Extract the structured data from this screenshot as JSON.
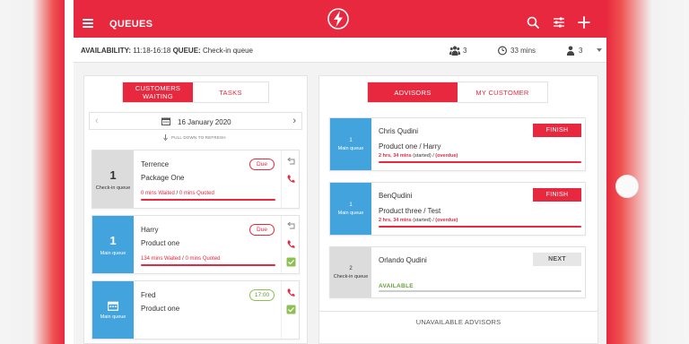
{
  "header": {
    "title": "QUEUES",
    "brand_color": "#e8283f",
    "icons": [
      "menu-icon",
      "lightning-logo-icon",
      "search-icon",
      "filter-sliders-icon",
      "plus-icon"
    ]
  },
  "availability_bar": {
    "availability_label": "AVAILABILITY:",
    "availability_value": "11:18-16:18",
    "queue_label": "QUEUE:",
    "queue_value": "Check-in queue",
    "people_count": "3",
    "wait_time": "33 mins",
    "advisors_count": "3"
  },
  "left_panel": {
    "tabs": [
      {
        "label": "CUSTOMERS WAITING",
        "active": true
      },
      {
        "label": "TASKS",
        "active": false
      }
    ],
    "date": "16 January 2020",
    "pull_hint": "PULL DOWN TO REFRESH",
    "customers": [
      {
        "number": "1",
        "queue": "Check-in queue",
        "name": "Terrence",
        "product": "Package One",
        "waited": "0 mins Waited",
        "separator": " / ",
        "quoted": "0 mins Quoted",
        "status": "Due"
      },
      {
        "number": "1",
        "queue": "Main queue",
        "name": "Harry",
        "product": "Product one",
        "waited": "134 mins Waited",
        "separator": " / ",
        "quoted": "0 mins Quoted",
        "status": "Due"
      },
      {
        "number": "",
        "queue": "Main queue",
        "name": "Fred",
        "product": "Product one",
        "waited": "",
        "separator": "",
        "quoted": "",
        "status": "17:00"
      }
    ]
  },
  "right_panel": {
    "tabs": [
      {
        "label": "ADVISORS",
        "active": true
      },
      {
        "label": "MY CUSTOMER",
        "active": false
      }
    ],
    "advisors": [
      {
        "number": "1",
        "queue": "Main queue",
        "name": "Chris Qudini",
        "product": "Product one / Harry",
        "elapsed": "2 hrs, 34 mins",
        "started": "(started) / ",
        "overdue": "(overdue)",
        "action": "FINISH"
      },
      {
        "number": "1",
        "queue": "Main queue",
        "name": "BenQudini",
        "product": "Product three / Test",
        "elapsed": "2 hrs, 34 mins",
        "started": "(started) / ",
        "overdue": "(overdue)",
        "action": "FINISH"
      },
      {
        "number": "2",
        "queue": "Check-in queue",
        "name": "Orlando Qudini",
        "status": "AVAILABLE",
        "action": "NEXT"
      }
    ],
    "unavailable_label": "UNAVAILABLE ADVISORS"
  }
}
